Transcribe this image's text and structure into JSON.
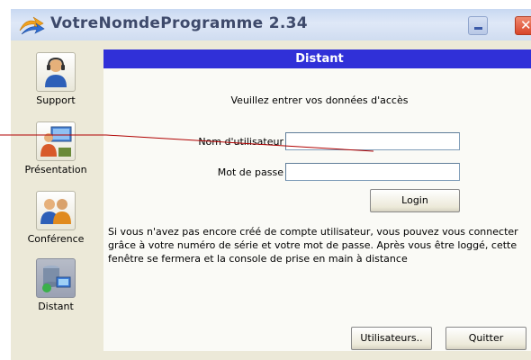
{
  "window": {
    "title": "VotreNomdeProgramme 2.34",
    "close_glyph": "✕"
  },
  "sidebar": {
    "items": [
      {
        "label": "Support",
        "icon": "support-icon",
        "selected": false
      },
      {
        "label": "Présentation",
        "icon": "presentation-icon",
        "selected": false
      },
      {
        "label": "Conférence",
        "icon": "conference-icon",
        "selected": false
      },
      {
        "label": "Distant",
        "icon": "remote-icon",
        "selected": true
      }
    ]
  },
  "panel": {
    "header": "Distant",
    "intro": "Veuillez entrer vos données d'accès",
    "username_label": "Nom d'utilisateur",
    "username_value": "",
    "password_label": "Mot de passe",
    "password_value": "",
    "login_button": "Login",
    "info_text": "Si vous n'avez pas encore créé de compte utilisateur, vous pouvez vous connecter grâce à votre numéro de série et votre mot de passe. Après vous être loggé, cette fenêtre se fermera et la console de prise en main à distance",
    "users_button": "Utilisateurs..",
    "quit_button": "Quitter"
  },
  "colors": {
    "header_blue": "#3030d8",
    "window_bg": "#ece9d8",
    "annotation_line": "#b00000"
  }
}
